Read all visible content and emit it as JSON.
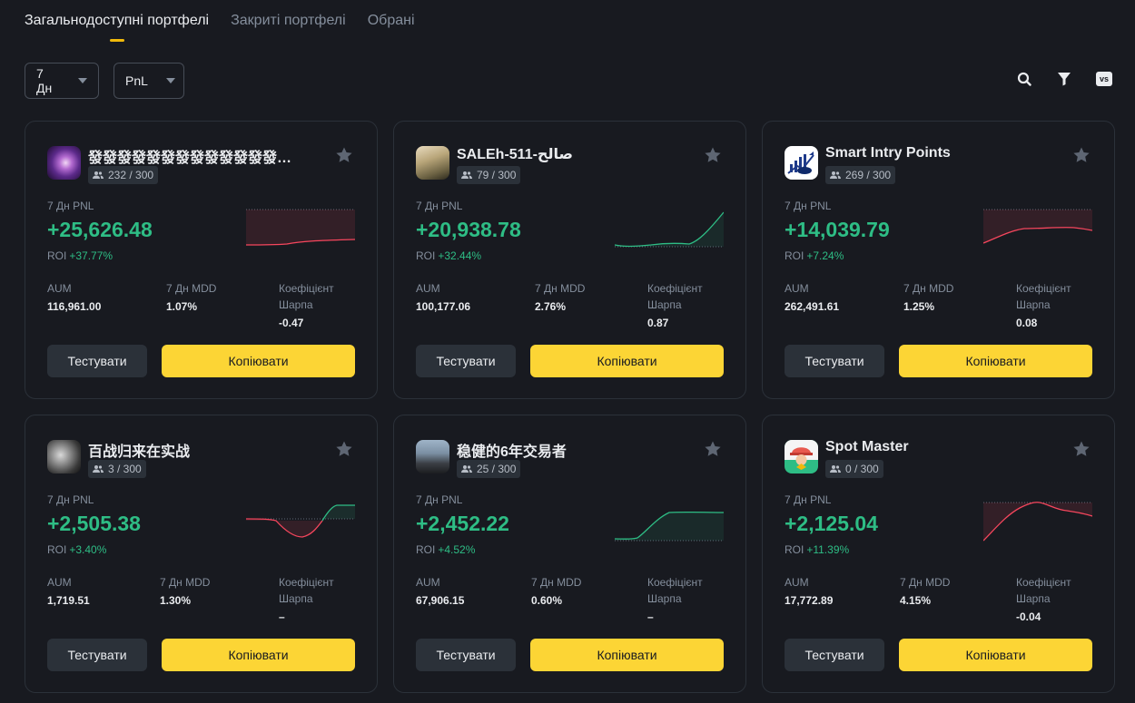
{
  "tabs": [
    {
      "label": "Загальнодоступні портфелі",
      "active": true
    },
    {
      "label": "Закриті портфелі",
      "active": false
    },
    {
      "label": "Обрані",
      "active": false
    }
  ],
  "filters": {
    "period": "7 Дн",
    "sort": "PnL"
  },
  "tools": {
    "vs_label": "vs"
  },
  "colors": {
    "accent": "#fcd535",
    "positive": "#2ebd85",
    "negative": "#f6465d",
    "background": "#181a20"
  },
  "card_labels": {
    "pnl": "7 Дн PNL",
    "roi": "ROI",
    "aum": "AUM",
    "mdd": "7 Дн MDD",
    "sharpe_line1": "Коефіцієнт",
    "sharpe_line2": "Шарпа",
    "test_button": "Тестувати",
    "copy_button": "Копіювати"
  },
  "cards": [
    {
      "name": "發發發發發發發發發發發發發發發發發發",
      "followers": "232 / 300",
      "pnl": "+25,626.48",
      "roi": "+37.77%",
      "aum": "116,961.00",
      "mdd": "1.07%",
      "sharpe": "-0.47"
    },
    {
      "name": "SALEh-511-صالح",
      "followers": "79 / 300",
      "pnl": "+20,938.78",
      "roi": "+32.44%",
      "aum": "100,177.06",
      "mdd": "2.76%",
      "sharpe": "0.87"
    },
    {
      "name": "Smart Intry Points",
      "followers": "269 / 300",
      "pnl": "+14,039.79",
      "roi": "+7.24%",
      "aum": "262,491.61",
      "mdd": "1.25%",
      "sharpe": "0.08"
    },
    {
      "name": "百战归来在实战",
      "followers": "3 / 300",
      "pnl": "+2,505.38",
      "roi": "+3.40%",
      "aum": "1,719.51",
      "mdd": "1.30%",
      "sharpe": "–"
    },
    {
      "name": "稳健的6年交易者",
      "followers": "25 / 300",
      "pnl": "+2,452.22",
      "roi": "+4.52%",
      "aum": "67,906.15",
      "mdd": "0.60%",
      "sharpe": "–"
    },
    {
      "name": "Spot Master",
      "followers": "0 / 300",
      "pnl": "+2,125.04",
      "roi": "+11.39%",
      "aum": "17,772.89",
      "mdd": "4.15%",
      "sharpe": "-0.04"
    }
  ]
}
